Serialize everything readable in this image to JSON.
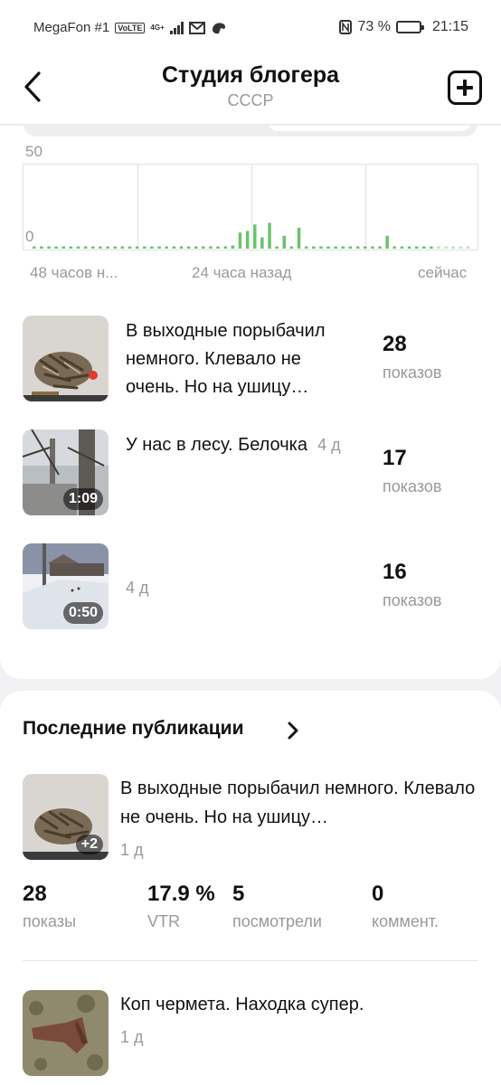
{
  "status_bar": {
    "carrier": "MegaFon #1",
    "volte": "VoLTE",
    "network": "4G+",
    "battery": "73 %",
    "time": "21:15"
  },
  "header": {
    "title": "Студия блогера",
    "subtitle": "СССР"
  },
  "chart_data": {
    "type": "bar",
    "ylim": [
      0,
      50
    ],
    "tick_labels": {
      "y_max": "50",
      "y_min": "0"
    },
    "x_labels": [
      "48 часов н...",
      "24 часа назад",
      "сейчас"
    ],
    "values": [
      0,
      0,
      0,
      0,
      0,
      0,
      0,
      0,
      0,
      0,
      0,
      0,
      0,
      0,
      0,
      0,
      0,
      0,
      0,
      0,
      0,
      0,
      0,
      0,
      0,
      0,
      1,
      2,
      10,
      11,
      15,
      7,
      16,
      0,
      8,
      0,
      13,
      0,
      0,
      0,
      0,
      0,
      0,
      0,
      0,
      0,
      0,
      0,
      8,
      0,
      0,
      0,
      0,
      0,
      0,
      0,
      0,
      0,
      0,
      0
    ],
    "grid": true,
    "color": "#6ac36e"
  },
  "top_posts": [
    {
      "text": "В выходные порыбачил немного. Клевало не очень. Но на ушицу…",
      "age": "",
      "duration": "",
      "views": "28",
      "views_label": "показов"
    },
    {
      "text": "У нас в лесу. Белочка",
      "age": "4 д",
      "duration": "1:09",
      "views": "17",
      "views_label": "показов"
    },
    {
      "text": "",
      "age": "4 д",
      "duration": "0:50",
      "views": "16",
      "views_label": "показов"
    }
  ],
  "recent": {
    "title": "Последние публикации",
    "items": [
      {
        "text": "В выходные порыбачил немного. Клевало не очень. Но на ушицу…",
        "age": "1 д",
        "badge": "+2",
        "stats": [
          {
            "value": "28",
            "label": "показы"
          },
          {
            "value": "17.9 %",
            "label": "VTR"
          },
          {
            "value": "5",
            "label": "посмотрели"
          },
          {
            "value": "0",
            "label": "коммент."
          }
        ]
      },
      {
        "text": "Коп чермета. Находка супер.",
        "age": "1 д"
      }
    ]
  },
  "colors": {
    "accent_green": "#6ac36e",
    "muted_text": "#999999"
  }
}
